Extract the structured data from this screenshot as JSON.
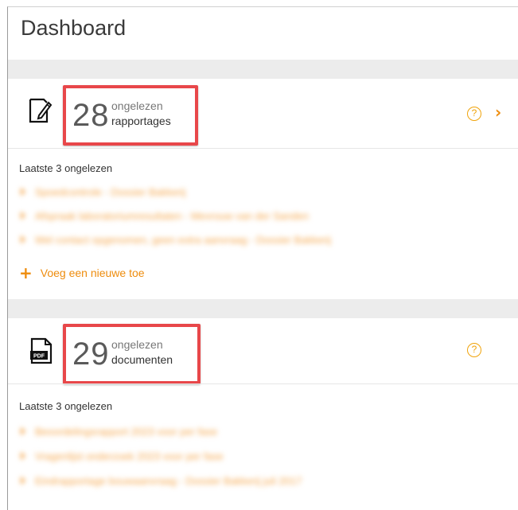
{
  "page": {
    "title": "Dashboard"
  },
  "reports": {
    "count": "28",
    "unread_word": "ongelezen",
    "type_label": "rapportages",
    "section_label": "Laatste 3 ongelezen",
    "items": [
      {
        "label": "Spoedcontrole - Dossier Bakkerij"
      },
      {
        "label": "Afspraak laboratoriumresultaten - Mevrouw van der Sanden"
      },
      {
        "label": "Wel contact opgenomen, geen extra aanvraag - Dossier Bakkerij"
      }
    ],
    "add_label": "Voeg een nieuwe toe"
  },
  "documents": {
    "count": "29",
    "unread_word": "ongelezen",
    "type_label": "documenten",
    "section_label": "Laatste 3 ongelezen",
    "items": [
      {
        "label": "Beoordelingsrapport 2023 voor per fase"
      },
      {
        "label": "Vragenlijst onderzoek 2023 voor per fase"
      },
      {
        "label": "Eindrapportage bouwaanvraag - Dossier Bakkerij juli 2017"
      }
    ]
  },
  "colors": {
    "accent": "#ee8c0d",
    "highlight_border": "#e8474a",
    "band": "#ececec"
  },
  "icons": {
    "reports": "edit-document-icon",
    "documents": "pdf-file-icon",
    "help": "question-circle-icon",
    "chevron": "chevron-right-icon",
    "add": "plus-icon"
  }
}
